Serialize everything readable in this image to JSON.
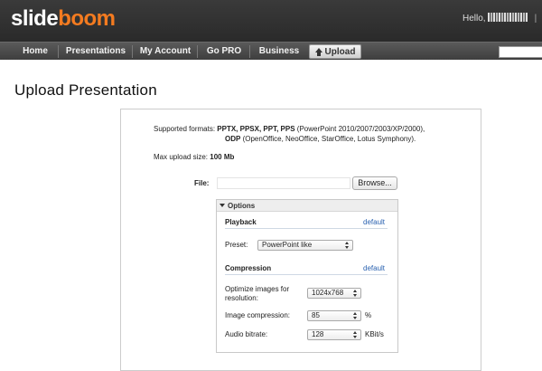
{
  "header": {
    "logo_part1": "slide",
    "logo_part2": "boom",
    "greeting": "Hello,",
    "divider": "|"
  },
  "nav": {
    "items": [
      "Home",
      "Presentations",
      "My Account",
      "Go PRO",
      "Business"
    ],
    "upload_label": "Upload"
  },
  "page": {
    "title": "Upload Presentation"
  },
  "formats": {
    "label": "Supported formats:",
    "list1": "PPTX, PPSX, PPT, PPS",
    "desc1": "(PowerPoint 2010/2007/2003/XP/2000),",
    "list2": "ODP",
    "desc2": "(OpenOffice, NeoOffice, StarOffice, Lotus Symphony)."
  },
  "max_upload": {
    "label": "Max upload size:",
    "value": "100 Mb"
  },
  "file": {
    "label": "File:",
    "value": "",
    "browse_label": "Browse..."
  },
  "options": {
    "header": "Options",
    "playback": {
      "title": "Playback",
      "default_link": "default",
      "preset_label": "Preset:",
      "preset_value": "PowerPoint like"
    },
    "compression": {
      "title": "Compression",
      "default_link": "default",
      "optimize_label_line1": "Optimize images for",
      "optimize_label_line2": "resolution:",
      "optimize_value": "1024x768",
      "image_compression_label": "Image compression:",
      "image_compression_value": "85",
      "image_compression_unit": "%",
      "audio_bitrate_label": "Audio bitrate:",
      "audio_bitrate_value": "128",
      "audio_bitrate_unit": "KBit/s"
    }
  },
  "colors": {
    "accent": "#f47b20",
    "link": "#2a62b0",
    "header_bg": "#2f2f2f"
  }
}
